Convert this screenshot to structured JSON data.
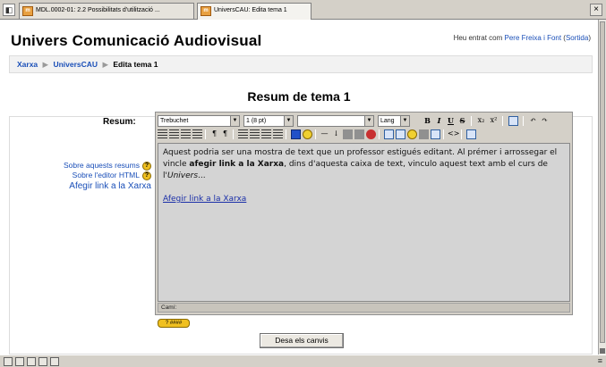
{
  "browser": {
    "left_icon": "◧",
    "tabs": [
      {
        "favicon": "m",
        "label": "MDL.0002-01: 2.2 Possibilitats d'utilització ..."
      },
      {
        "favicon": "m",
        "label": "UniversCAU: Edita tema 1"
      }
    ],
    "close": "×"
  },
  "header": {
    "site_title": "Univers Comunicació Audiovisual",
    "login_prefix": "Heu entrat com",
    "login_user": "Pere Freixa i Font",
    "logout": "Sortida"
  },
  "breadcrumb": {
    "items": [
      "Xarxa",
      "UniversCAU"
    ],
    "current": "Edita tema 1",
    "separator": "▶"
  },
  "main": {
    "heading": "Resum de tema 1",
    "field_label": "Resum:",
    "help": {
      "about_summaries": "Sobre aquests resums",
      "about_editor": "Sobre l'editor HTML",
      "add_link": "Afegir link a la Xarxa"
    },
    "editor": {
      "font": "Trebuchet",
      "size": "1 (8 pt)",
      "style": "",
      "lang": "Lang",
      "buttons": {
        "bold": "B",
        "italic": "I",
        "underline": "U",
        "strike": "S",
        "sub": "x₂",
        "sup": "x²",
        "undo": "↶",
        "redo": "↷",
        "ltr": "¶",
        "rtl": "¶",
        "hr": "—",
        "anchor": "↓",
        "source": "<>"
      },
      "text_1": "Aquest podria ser una mostra de text que un professor estigués editant. Al prémer i arrossegar el vincle ",
      "text_bold": "afegir link a la Xarxa",
      "text_2": ", dins d'aquesta caixa de text, vinculo aquest text amb el curs de l'",
      "text_italic": "Univers",
      "text_3": "...",
      "link_text": "Afegir link a la Xarxa",
      "path_label": "Camí:"
    },
    "resize_label": "?   ####",
    "save_button": "Desa els canvis"
  },
  "statusbar": {
    "right": "≡"
  }
}
